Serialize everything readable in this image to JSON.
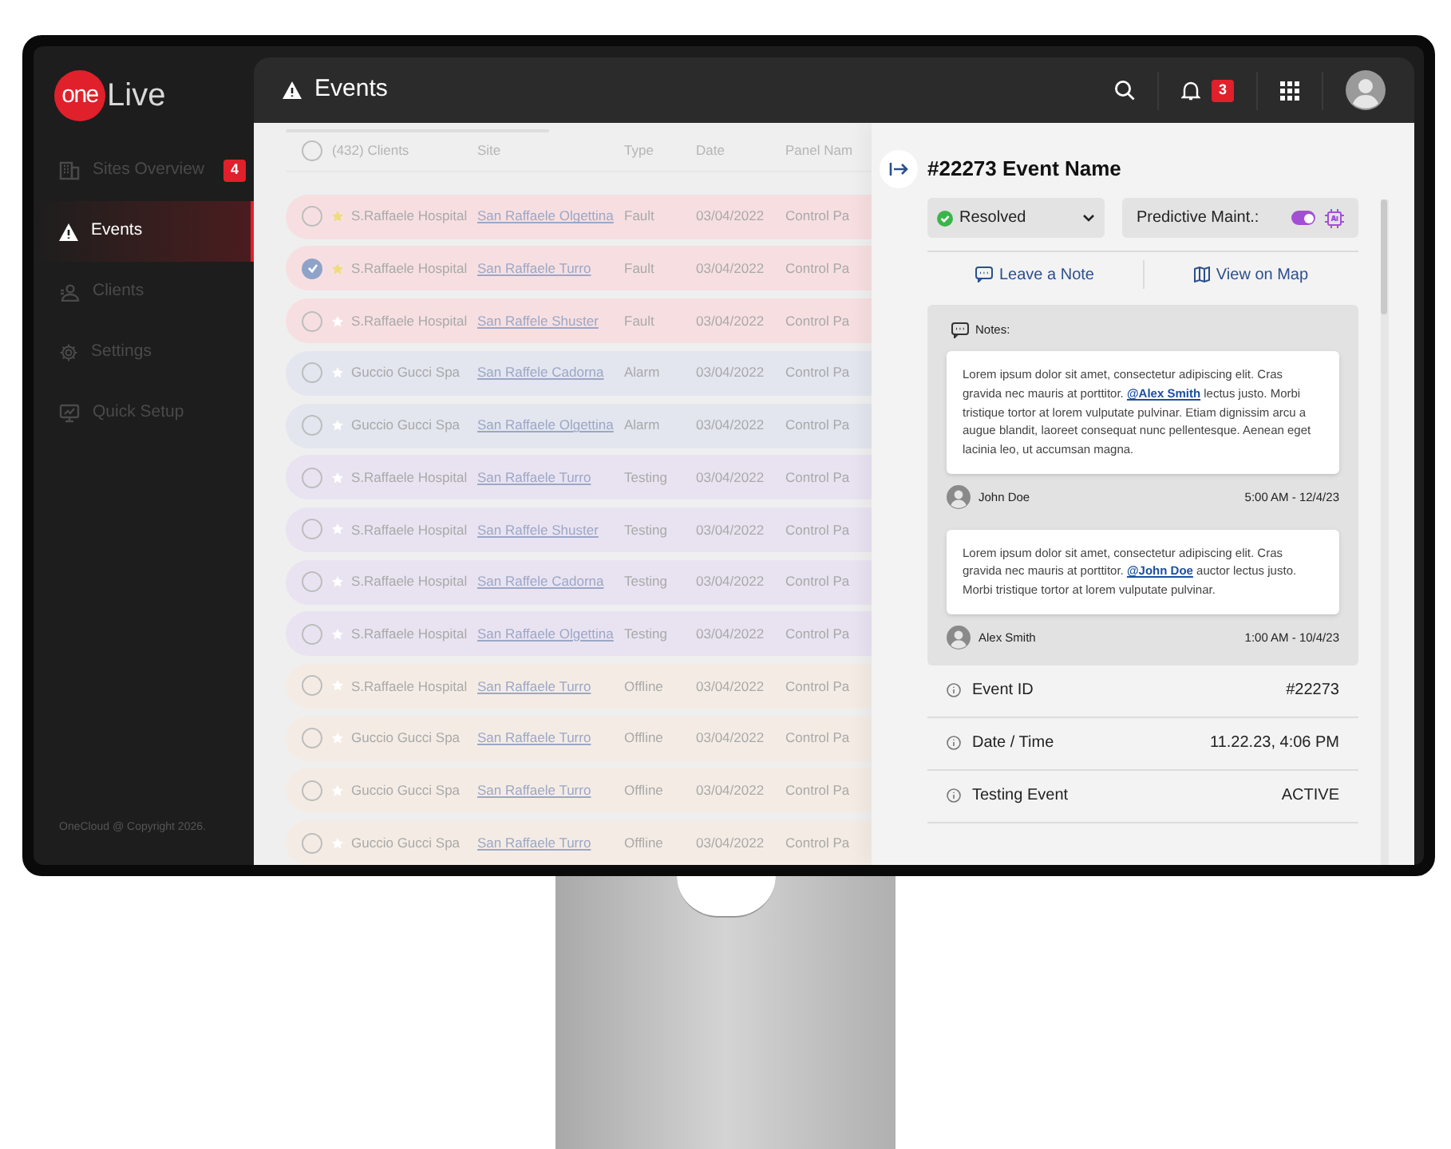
{
  "sidebar": {
    "logo": {
      "mark": "one",
      "text": "Live"
    },
    "items": [
      {
        "label": "Sites Overview",
        "selected": false,
        "badge": "4"
      },
      {
        "label": "Events",
        "selected": true
      },
      {
        "label": "Clients",
        "selected": false
      },
      {
        "label": "Settings",
        "selected": false
      },
      {
        "label": "Quick Setup",
        "selected": false
      }
    ],
    "copyright": "OneCloud @ Copyright 2026."
  },
  "header": {
    "title": "Events",
    "notification_count": "3"
  },
  "table": {
    "header": {
      "checked": false,
      "clients": "(432) Clients",
      "columns": [
        "Site",
        "Type",
        "Date",
        "Panel Nam"
      ]
    },
    "rows": [
      {
        "checked": false,
        "starred": true,
        "client": "S.Raffaele Hospital",
        "site": "San Raffaele Olgettina",
        "type": "Fault",
        "date": "03/04/2022",
        "panel": "Control Pa",
        "color": "#f7dfe1"
      },
      {
        "checked": true,
        "starred": true,
        "client": "S.Raffaele Hospital",
        "site": "San Raffaele Turro",
        "type": "Fault",
        "date": "03/04/2022",
        "panel": "Control Pa",
        "color": "#f7dfe1"
      },
      {
        "checked": false,
        "starred": false,
        "client": "S.Raffaele Hospital",
        "site": "San Raffele Shuster",
        "type": "Fault",
        "date": "03/04/2022",
        "panel": "Control Pa",
        "color": "#f7dfe1"
      },
      {
        "checked": false,
        "starred": false,
        "client": "Guccio Gucci Spa",
        "site": "San Raffele Cadorna",
        "type": "Alarm",
        "date": "03/04/2022",
        "panel": "Control Pa",
        "color": "#e3e6ef"
      },
      {
        "checked": false,
        "starred": false,
        "client": "Guccio Gucci Spa",
        "site": "San Raffaele Olgettina",
        "type": "Alarm",
        "date": "03/04/2022",
        "panel": "Control Pa",
        "color": "#e3e6ef"
      },
      {
        "checked": false,
        "starred": false,
        "client": "S.Raffaele Hospital",
        "site": "San Raffaele Turro",
        "type": "Testing",
        "date": "03/04/2022",
        "panel": "Control Pa",
        "color": "#e9e3f1"
      },
      {
        "checked": false,
        "starred": false,
        "client": "S.Raffaele Hospital",
        "site": "San Raffele Shuster",
        "type": "Testing",
        "date": "03/04/2022",
        "panel": "Control Pa",
        "color": "#e9e3f1"
      },
      {
        "checked": false,
        "starred": false,
        "client": "S.Raffaele Hospital",
        "site": "San Raffele Cadorna",
        "type": "Testing",
        "date": "03/04/2022",
        "panel": "Control Pa",
        "color": "#e9e3f1"
      },
      {
        "checked": false,
        "starred": false,
        "client": "S.Raffaele Hospital",
        "site": "San Raffaele Olgettina",
        "type": "Testing",
        "date": "03/04/2022",
        "panel": "Control Pa",
        "color": "#e9e3f1"
      },
      {
        "checked": false,
        "starred": false,
        "client": "S.Raffaele Hospital",
        "site": "San Raffaele Turro",
        "type": "Offline",
        "date": "03/04/2022",
        "panel": "Control Pa",
        "color": "#f4ece4"
      },
      {
        "checked": false,
        "starred": false,
        "client": "Guccio Gucci Spa",
        "site": "San Raffaele Turro",
        "type": "Offline",
        "date": "03/04/2022",
        "panel": "Control Pa",
        "color": "#f4ece4"
      },
      {
        "checked": false,
        "starred": false,
        "client": "Guccio Gucci Spa",
        "site": "San Raffaele Turro",
        "type": "Offline",
        "date": "03/04/2022",
        "panel": "Control Pa",
        "color": "#f4ece4"
      },
      {
        "checked": false,
        "starred": false,
        "client": "Guccio Gucci Spa",
        "site": "San Raffaele Turro",
        "type": "Offline",
        "date": "03/04/2022",
        "panel": "Control Pa",
        "color": "#f4ece4"
      }
    ]
  },
  "panel": {
    "title": "#22273 Event Name",
    "status": "Resolved",
    "toggle": {
      "label": "Predictive Maint.:",
      "on": true
    },
    "actions": [
      "Leave a Note",
      "View on Map"
    ],
    "notes": {
      "label": "Notes:",
      "items": [
        {
          "before": "Lorem ipsum dolor sit amet, consectetur adipiscing elit. Cras gravida nec mauris at porttitor. ",
          "mention": "@Alex Smith",
          "after": " lectus justo. Morbi tristique tortor at lorem vulputate pulvinar. Etiam dignissim arcu a augue blandit, laoreet consequat nunc pellentesque. Aenean eget lacinia leo, ut accumsan magna.",
          "author": "John Doe",
          "time": "5:00 AM - 12/4/23"
        },
        {
          "before": "Lorem ipsum dolor sit amet, consectetur adipiscing elit. Cras gravida nec mauris at porttitor. ",
          "mention": "@John Doe",
          "after": " auctor lectus justo. Morbi tristique tortor at lorem vulputate pulvinar.",
          "author": "Alex Smith",
          "time": "1:00 AM - 10/4/23"
        }
      ]
    },
    "details": [
      {
        "label": "Event ID",
        "value": "#22273"
      },
      {
        "label": "Date / Time",
        "value": "11.22.23, 4:06 PM"
      },
      {
        "label": "Testing Event",
        "value": "ACTIVE"
      }
    ]
  }
}
